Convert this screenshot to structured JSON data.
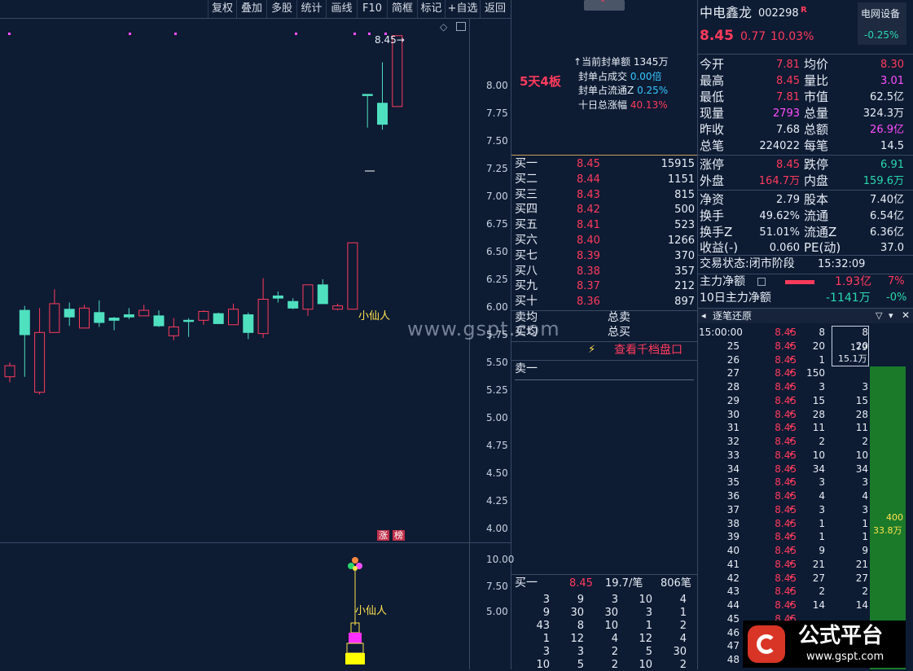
{
  "toolbar": [
    "复权",
    "叠加",
    "多股",
    "统计",
    "画线",
    "F10",
    "简框",
    "标记",
    "+自选",
    "返回"
  ],
  "stock": {
    "name": "中电鑫龙",
    "code": "002298",
    "badge": "R",
    "sector": "电网设备",
    "sector_pct": "-0.25%",
    "price": "8.45",
    "change": "0.77",
    "pct": "10.03%"
  },
  "yaxis": [
    "8.00",
    "7.75",
    "7.50",
    "7.25",
    "7.00",
    "6.75",
    "6.50",
    "6.25",
    "6.00",
    "5.75",
    "5.50",
    "5.25",
    "5.00",
    "4.75",
    "4.50",
    "4.25",
    "4.00"
  ],
  "yaxis2": [
    "10.00",
    "7.50",
    "5.00"
  ],
  "chart": {
    "last_price": "8.45",
    "label_xxr": "小仙人",
    "label_zb1": "涨",
    "label_zb2": "榜",
    "watermark": "www.gspt.com"
  },
  "seal": {
    "tag": "5天4板",
    "l1": "当前封单额",
    "v1": "1345万",
    "l2": "封单占成交",
    "v2": "0.00倍",
    "l3": "封单占流通Z",
    "v3": "0.25%",
    "l4": "十日总涨幅",
    "v4": "40.13%"
  },
  "bids": [
    {
      "n": "买一",
      "p": "8.45",
      "v": "15915"
    },
    {
      "n": "买二",
      "p": "8.44",
      "v": "1151"
    },
    {
      "n": "买三",
      "p": "8.43",
      "v": "815"
    },
    {
      "n": "买四",
      "p": "8.42",
      "v": "500"
    },
    {
      "n": "买五",
      "p": "8.41",
      "v": "523"
    },
    {
      "n": "买六",
      "p": "8.40",
      "v": "1266"
    },
    {
      "n": "买七",
      "p": "8.39",
      "v": "370"
    },
    {
      "n": "买八",
      "p": "8.38",
      "v": "357"
    },
    {
      "n": "买九",
      "p": "8.37",
      "v": "212"
    },
    {
      "n": "买十",
      "p": "8.36",
      "v": "897"
    }
  ],
  "avg": {
    "sell_avg": "卖均",
    "sell_total": "总卖",
    "buy_avg": "买均",
    "buy_total": "总买",
    "link": "查看千档盘口",
    "ask1": "卖一"
  },
  "queue": {
    "label": "买一",
    "price": "8.45",
    "per": "19.7/笔",
    "count": "806笔",
    "rows": [
      [
        "3",
        "9",
        "3",
        "10",
        "4"
      ],
      [
        "9",
        "30",
        "30",
        "3",
        "1"
      ],
      [
        "43",
        "8",
        "10",
        "1",
        "2"
      ],
      [
        "1",
        "12",
        "4",
        "12",
        "4"
      ],
      [
        "3",
        "3",
        "2",
        "5",
        "30"
      ],
      [
        "10",
        "5",
        "2",
        "10",
        "2"
      ]
    ]
  },
  "quote": [
    {
      "l": "今开",
      "v": "7.81",
      "c": "red",
      "l2": "均价",
      "v2": "8.30",
      "c2": "red"
    },
    {
      "l": "最高",
      "v": "8.45",
      "c": "red",
      "l2": "量比",
      "v2": "3.01",
      "c2": "mag"
    },
    {
      "l": "最低",
      "v": "7.81",
      "c": "red",
      "l2": "市值",
      "v2": "62.5亿",
      "c2": "wht"
    },
    {
      "l": "现量",
      "v": "2793",
      "c": "mag",
      "l2": "总量",
      "v2": "324.3万",
      "c2": "wht"
    },
    {
      "l": "昨收",
      "v": "7.68",
      "c": "wht",
      "l2": "总额",
      "v2": "26.9亿",
      "c2": "mag"
    },
    {
      "l": "总笔",
      "v": "224022",
      "c": "wht",
      "l2": "每笔",
      "v2": "14.5",
      "c2": "wht"
    }
  ],
  "quote2": [
    {
      "l": "涨停",
      "v": "8.45",
      "c": "red",
      "l2": "跌停",
      "v2": "6.91",
      "c2": "grn"
    },
    {
      "l": "外盘",
      "v": "164.7万",
      "c": "red",
      "l2": "内盘",
      "v2": "159.6万",
      "c2": "grn"
    }
  ],
  "quote3": [
    {
      "l": "净资",
      "v": "2.79",
      "l2": "股本",
      "v2": "7.40亿"
    },
    {
      "l": "换手",
      "v": "49.62%",
      "l2": "流通",
      "v2": "6.54亿"
    },
    {
      "l": "换手Z",
      "v": "51.01%",
      "l2": "流通Z",
      "v2": "6.36亿"
    },
    {
      "l": "收益(-)",
      "v": "0.060",
      "l2": "PE(动)",
      "v2": "37.0"
    }
  ],
  "status": {
    "l": "交易状态:",
    "v": "闭市阶段",
    "t": "15:32:09"
  },
  "flow": {
    "l1": "主力净额",
    "v1": "1.93亿",
    "p1": "7%",
    "l2": "10日主力净额",
    "v2": "-1141万",
    "p2": "-0%"
  },
  "ticks": {
    "title": "逐笔还原",
    "box1": "179",
    "box2": "15.1万",
    "bar1": "400",
    "bar2": "33.8万",
    "rows": [
      [
        "15:00:00",
        "8.45",
        "8",
        "8"
      ],
      [
        "25",
        "8.45",
        "20",
        "20"
      ],
      [
        "26",
        "8.45",
        "1",
        ""
      ],
      [
        "27",
        "8.45",
        "150",
        ""
      ],
      [
        "28",
        "8.45",
        "3",
        "3"
      ],
      [
        "29",
        "8.45",
        "15",
        "15"
      ],
      [
        "30",
        "8.45",
        "28",
        "28"
      ],
      [
        "31",
        "8.45",
        "11",
        "11"
      ],
      [
        "32",
        "8.45",
        "2",
        "2"
      ],
      [
        "33",
        "8.45",
        "10",
        "10"
      ],
      [
        "34",
        "8.45",
        "34",
        "34"
      ],
      [
        "35",
        "8.45",
        "3",
        "3"
      ],
      [
        "36",
        "8.45",
        "4",
        "4"
      ],
      [
        "37",
        "8.45",
        "3",
        "3"
      ],
      [
        "38",
        "8.45",
        "1",
        "1"
      ],
      [
        "39",
        "8.45",
        "1",
        "1"
      ],
      [
        "40",
        "8.45",
        "9",
        "9"
      ],
      [
        "41",
        "8.45",
        "21",
        "21"
      ],
      [
        "42",
        "8.45",
        "27",
        "27"
      ],
      [
        "43",
        "8.45",
        "2",
        "2"
      ],
      [
        "44",
        "8.45",
        "14",
        "14"
      ],
      [
        "45",
        "8.45",
        "",
        ""
      ],
      [
        "46",
        "8.45",
        "",
        ""
      ],
      [
        "47",
        "8.45",
        "",
        ""
      ],
      [
        "48",
        "8.45",
        "",
        ""
      ]
    ]
  },
  "logo": {
    "name": "公式平台",
    "url": "www.gspt.com"
  },
  "chart_data": {
    "type": "candlestick",
    "candles": [
      {
        "o": 5.47,
        "h": 5.5,
        "l": 5.32,
        "c": 5.37,
        "dir": "up"
      },
      {
        "o": 5.75,
        "h": 6.01,
        "l": 5.37,
        "c": 5.97,
        "dir": "dn"
      },
      {
        "o": 5.77,
        "h": 5.99,
        "l": 5.21,
        "c": 5.23,
        "dir": "up"
      },
      {
        "o": 5.77,
        "h": 6.16,
        "l": 5.77,
        "c": 6.03,
        "dir": "up"
      },
      {
        "o": 5.91,
        "h": 6.04,
        "l": 5.83,
        "c": 5.98,
        "dir": "dn"
      },
      {
        "o": 5.81,
        "h": 6.02,
        "l": 5.81,
        "c": 5.99,
        "dir": "up"
      },
      {
        "o": 5.86,
        "h": 6.06,
        "l": 5.82,
        "c": 5.95,
        "dir": "dn"
      },
      {
        "o": 5.9,
        "h": 5.91,
        "l": 5.79,
        "c": 5.88,
        "dir": "dn"
      },
      {
        "o": 5.91,
        "h": 5.99,
        "l": 5.89,
        "c": 5.93,
        "dir": "dn"
      },
      {
        "o": 5.92,
        "h": 6.02,
        "l": 5.92,
        "c": 5.97,
        "dir": "up"
      },
      {
        "o": 5.92,
        "h": 5.97,
        "l": 5.82,
        "c": 5.83,
        "dir": "dn"
      },
      {
        "o": 5.74,
        "h": 5.9,
        "l": 5.7,
        "c": 5.82,
        "dir": "up"
      },
      {
        "o": 5.88,
        "h": 5.9,
        "l": 5.73,
        "c": 5.88,
        "dir": "dn"
      },
      {
        "o": 5.88,
        "h": 5.97,
        "l": 5.84,
        "c": 5.96,
        "dir": "up"
      },
      {
        "o": 5.94,
        "h": 5.95,
        "l": 5.85,
        "c": 5.85,
        "dir": "dn"
      },
      {
        "o": 5.84,
        "h": 6.03,
        "l": 5.84,
        "c": 5.98,
        "dir": "up"
      },
      {
        "o": 5.93,
        "h": 5.95,
        "l": 5.71,
        "c": 5.77,
        "dir": "dn"
      },
      {
        "o": 5.76,
        "h": 6.26,
        "l": 5.72,
        "c": 6.07,
        "dir": "up"
      },
      {
        "o": 6.1,
        "h": 6.14,
        "l": 6.04,
        "c": 6.08,
        "dir": "dn"
      },
      {
        "o": 6.05,
        "h": 6.08,
        "l": 5.98,
        "c": 5.99,
        "dir": "dn"
      },
      {
        "o": 5.98,
        "h": 6.2,
        "l": 5.92,
        "c": 6.2,
        "dir": "up"
      },
      {
        "o": 6.03,
        "h": 6.25,
        "l": 6.03,
        "c": 6.2,
        "dir": "dn"
      },
      {
        "o": 5.98,
        "h": 6.03,
        "l": 5.97,
        "c": 6.01,
        "dir": "up"
      },
      {
        "o": 5.98,
        "h": 6.58,
        "l": 5.98,
        "c": 6.58,
        "dir": "up"
      },
      {
        "o": 7.92,
        "h": 7.92,
        "l": 7.62,
        "c": 7.92,
        "dir": "dn"
      },
      {
        "o": 7.65,
        "h": 8.21,
        "l": 7.6,
        "c": 7.84,
        "dir": "dn"
      },
      {
        "o": 7.81,
        "h": 8.45,
        "l": 7.81,
        "c": 8.45,
        "dir": "up"
      }
    ],
    "ylim": [
      3.9,
      8.5
    ]
  }
}
